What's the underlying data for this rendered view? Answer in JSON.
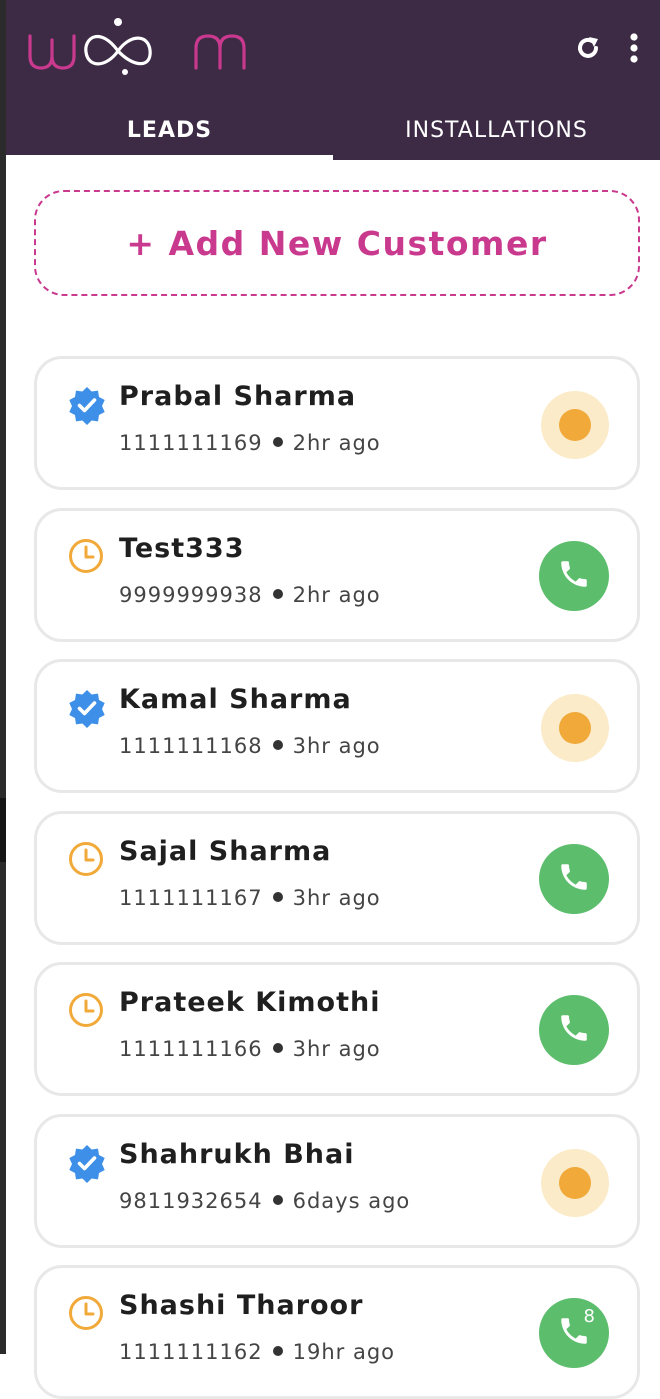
{
  "app": {
    "brand": "woom"
  },
  "tabs": [
    {
      "label": "LEADS",
      "active": true
    },
    {
      "label": "INSTALLATIONS",
      "active": false
    }
  ],
  "add_customer": {
    "label": "+ Add New Customer"
  },
  "colors": {
    "appbar": "#3d2b45",
    "brand_accent": "#c9398e",
    "verified": "#3d8fe8",
    "pending": "#f1a93a",
    "call": "#5cbd6c"
  },
  "leads": [
    {
      "name": "Prabal Sharma",
      "phone": "1111111169",
      "time": "2hr ago",
      "status_icon": "verified-badge-icon",
      "action": "pending"
    },
    {
      "name": "Test333",
      "phone": "9999999938",
      "time": "2hr ago",
      "status_icon": "clock-icon",
      "action": "call"
    },
    {
      "name": "Kamal Sharma",
      "phone": "1111111168",
      "time": "3hr ago",
      "status_icon": "verified-badge-icon",
      "action": "pending"
    },
    {
      "name": "Sajal Sharma",
      "phone": "1111111167",
      "time": "3hr ago",
      "status_icon": "clock-icon",
      "action": "call"
    },
    {
      "name": "Prateek Kimothi",
      "phone": "1111111166",
      "time": "3hr ago",
      "status_icon": "clock-icon",
      "action": "call"
    },
    {
      "name": "Shahrukh Bhai",
      "phone": "9811932654",
      "time": "6days ago",
      "status_icon": "verified-badge-icon",
      "action": "pending"
    },
    {
      "name": "Shashi Tharoor",
      "phone": "1111111162",
      "time": "19hr ago",
      "status_icon": "clock-icon",
      "action": "call",
      "call_count": "8"
    }
  ]
}
